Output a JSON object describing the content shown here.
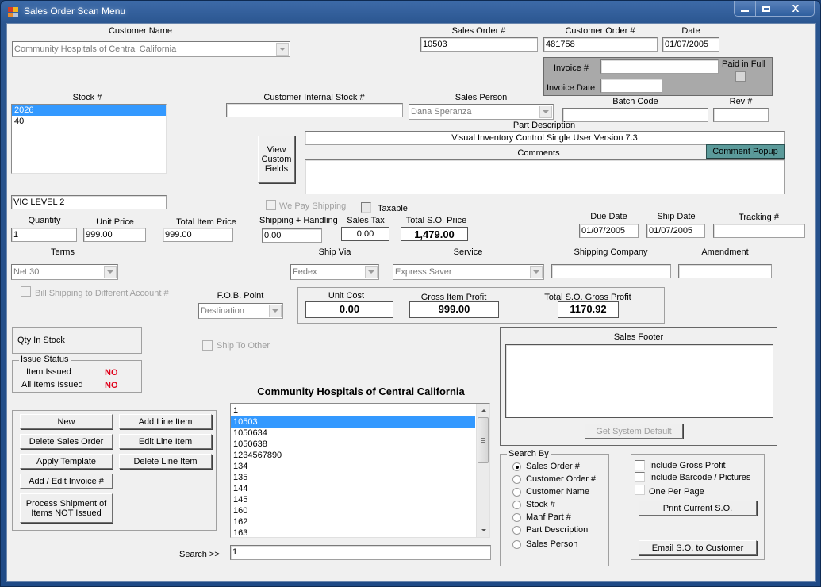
{
  "window": {
    "title": "Sales Order Scan Menu",
    "controls": {
      "minimize": "minimize",
      "maximize": "maximize",
      "close": "X"
    }
  },
  "customer": {
    "label": "Customer Name",
    "value": "Community Hospitals of Central California"
  },
  "sales_order": {
    "label": "Sales Order #",
    "value": "10503"
  },
  "customer_order": {
    "label": "Customer Order #",
    "value": "481758"
  },
  "date": {
    "label": "Date",
    "value": "01/07/2005"
  },
  "invoice": {
    "number_label": "Invoice #",
    "number_value": "",
    "date_label": "Invoice Date",
    "date_value": "",
    "paid_label": "Paid in Full",
    "paid_checked": false
  },
  "stock": {
    "label": "Stock #",
    "items": [
      {
        "value": "2026",
        "selected": true
      },
      {
        "value": "40",
        "selected": false
      }
    ],
    "level": "VIC LEVEL 2"
  },
  "customer_internal_stock": {
    "label": "Customer Internal Stock #",
    "value": ""
  },
  "sales_person": {
    "label": "Sales Person",
    "value": "Dana Speranza"
  },
  "batch_code": {
    "label": "Batch Code",
    "value": ""
  },
  "rev": {
    "label": "Rev #",
    "value": ""
  },
  "view_custom_fields_label": "View Custom Fields",
  "part_description": {
    "label": "Part Description",
    "value": "Visual Inventory Control Single User Version 7.3"
  },
  "comments": {
    "label": "Comments",
    "value": "",
    "popup_label": "Comment Popup",
    "popup_color": "#5b9a9a"
  },
  "we_pay_shipping": {
    "label": "We Pay Shipping",
    "checked": false,
    "enabled": false
  },
  "taxable": {
    "label": "Taxable",
    "checked": false
  },
  "pricing": {
    "quantity_label": "Quantity",
    "quantity": "1",
    "unit_price_label": "Unit Price",
    "unit_price": "999.00",
    "total_item_price_label": "Total Item Price",
    "total_item_price": "999.00",
    "shipping_label": "Shipping + Handling",
    "shipping": "0.00",
    "sales_tax_label": "Sales Tax",
    "sales_tax": "0.00",
    "total_so_price_label": "Total S.O. Price",
    "total_so_price": "1,479.00"
  },
  "dates": {
    "due_label": "Due Date",
    "due": "01/07/2005",
    "ship_label": "Ship Date",
    "ship": "01/07/2005",
    "tracking_label": "Tracking #",
    "tracking": ""
  },
  "terms": {
    "label": "Terms",
    "value": "Net 30"
  },
  "ship_via": {
    "label": "Ship Via",
    "value": "Fedex"
  },
  "service": {
    "label": "Service",
    "value": "Express Saver"
  },
  "shipping_company": {
    "label": "Shipping Company",
    "value": ""
  },
  "amendment": {
    "label": "Amendment",
    "value": ""
  },
  "bill_shipping": {
    "label": "Bill Shipping to Different Account #",
    "checked": false,
    "enabled": false
  },
  "fob": {
    "label": "F.O.B. Point",
    "value": "Destination"
  },
  "profit": {
    "unit_cost_label": "Unit Cost",
    "unit_cost": "0.00",
    "gross_item_label": "Gross Item Profit",
    "gross_item": "999.00",
    "total_gross_label": "Total S.O. Gross Profit",
    "total_gross": "1170.92"
  },
  "qty_in_stock_label": "Qty In Stock",
  "ship_to_other": {
    "label": "Ship To Other",
    "checked": false,
    "enabled": false
  },
  "issue_status": {
    "title": "Issue Status",
    "item_issued_label": "Item Issued",
    "item_issued": "NO",
    "all_issued_label": "All Items Issued",
    "all_issued": "NO"
  },
  "sales_footer": {
    "label": "Sales Footer",
    "value": "",
    "default_button": "Get System Default"
  },
  "actions": {
    "new": "New",
    "delete_so": "Delete Sales Order",
    "apply_template": "Apply Template",
    "add_edit_invoice": "Add / Edit Invoice #",
    "process_shipment": "Process Shipment of Items NOT Issued",
    "add_line": "Add Line Item",
    "edit_line": "Edit Line Item",
    "delete_line": "Delete Line Item"
  },
  "order_list": {
    "title": "Community Hospitals of Central California",
    "items": [
      {
        "value": "1",
        "selected": false
      },
      {
        "value": "10503",
        "selected": true
      },
      {
        "value": "1050634",
        "selected": false
      },
      {
        "value": "1050638",
        "selected": false
      },
      {
        "value": "1234567890",
        "selected": false
      },
      {
        "value": "134",
        "selected": false
      },
      {
        "value": "135",
        "selected": false
      },
      {
        "value": "144",
        "selected": false
      },
      {
        "value": "145",
        "selected": false
      },
      {
        "value": "160",
        "selected": false
      },
      {
        "value": "162",
        "selected": false
      },
      {
        "value": "163",
        "selected": false
      }
    ]
  },
  "search": {
    "label": "Search >>",
    "value": "1"
  },
  "search_by": {
    "title": "Search By",
    "options": [
      {
        "label": "Sales Order #",
        "selected": true
      },
      {
        "label": "Customer Order #",
        "selected": false
      },
      {
        "label": "Customer Name",
        "selected": false
      },
      {
        "label": "Stock #",
        "selected": false
      },
      {
        "label": "Manf Part #",
        "selected": false
      },
      {
        "label": "Part Description",
        "selected": false
      },
      {
        "label": "Sales Person",
        "selected": false
      }
    ]
  },
  "print_options": {
    "include_gross_profit": {
      "label": "Include Gross Profit",
      "checked": false
    },
    "include_barcode": {
      "label": "Include Barcode / Pictures",
      "checked": false
    },
    "one_per_page": {
      "label": "One Per Page",
      "checked": false
    },
    "print_button": "Print Current S.O.",
    "email_button": "Email S.O. to Customer"
  }
}
